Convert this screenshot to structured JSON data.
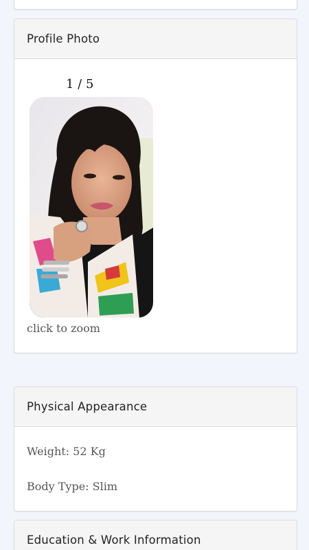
{
  "profile_photo": {
    "title": "Profile Photo",
    "counter": "1 / 5",
    "photo_label": "profile-photo",
    "zoom_hint": "click to zoom"
  },
  "physical": {
    "title": "Physical Appearance",
    "weight_text": "Weight:  52 Kg",
    "body_type_text": "Body Type: Slim"
  },
  "education": {
    "title": "Education & Work Information"
  },
  "colors": {
    "page_bg": "#f2f6fc",
    "card_bg": "#ffffff",
    "header_bg": "#f5f5f5",
    "border": "#dcdcdc"
  }
}
